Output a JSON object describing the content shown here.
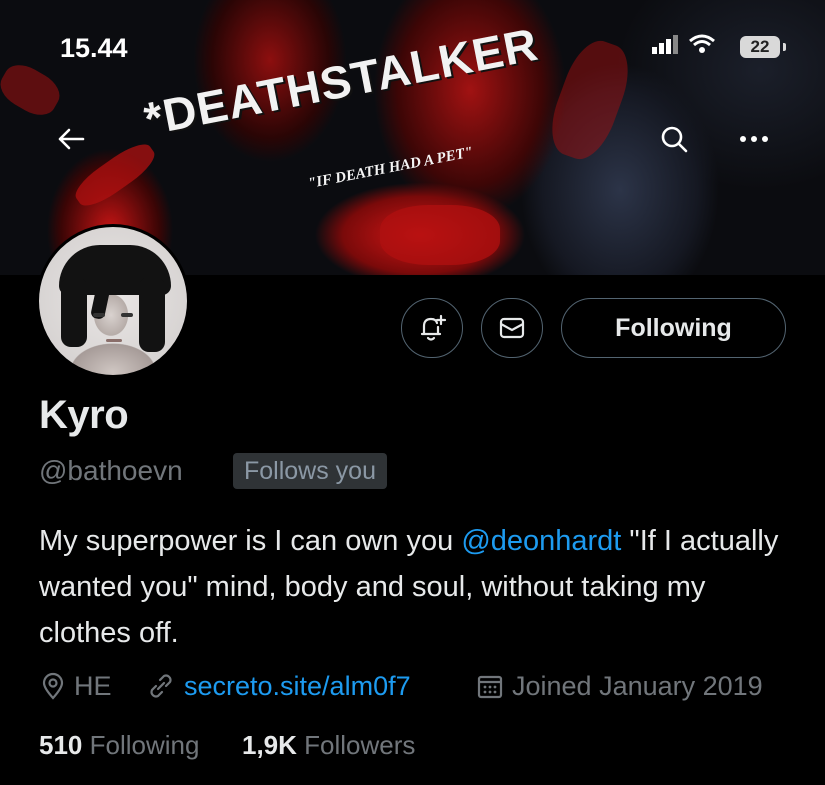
{
  "status_bar": {
    "time": "15.44",
    "battery": "22",
    "icons": [
      "signal-icon",
      "wifi-icon",
      "battery-icon"
    ]
  },
  "header": {
    "banner_title": "*DEATHSTALKER",
    "banner_subtitle": "\"IF DEATH HAD A PET\"",
    "icons": [
      "back-arrow-icon",
      "search-icon",
      "more-icon"
    ]
  },
  "actions": {
    "notify_icon": "bell-plus-icon",
    "message_icon": "mail-icon",
    "follow_label": "Following"
  },
  "profile": {
    "display_name": "Kyro",
    "handle": "@bathoevn",
    "follows_you": "Follows you",
    "bio_before": "My superpower is I can own you ",
    "bio_mention": "@deonhardt",
    "bio_after": " \"If I actually wanted you\" mind, body and soul, without taking my clothes off."
  },
  "meta": {
    "location": "HE",
    "website": "secreto.site/alm0f7",
    "joined": "Joined January 2019"
  },
  "stats": {
    "following_count": "510",
    "following_label": "Following",
    "followers_count": "1,9K",
    "followers_label": "Followers"
  },
  "colors": {
    "background": "#000000",
    "text": "#e7e9ea",
    "muted": "#71767b",
    "accent_link": "#1d9bf0",
    "border": "#536471",
    "badge_bg": "#2f3336"
  }
}
